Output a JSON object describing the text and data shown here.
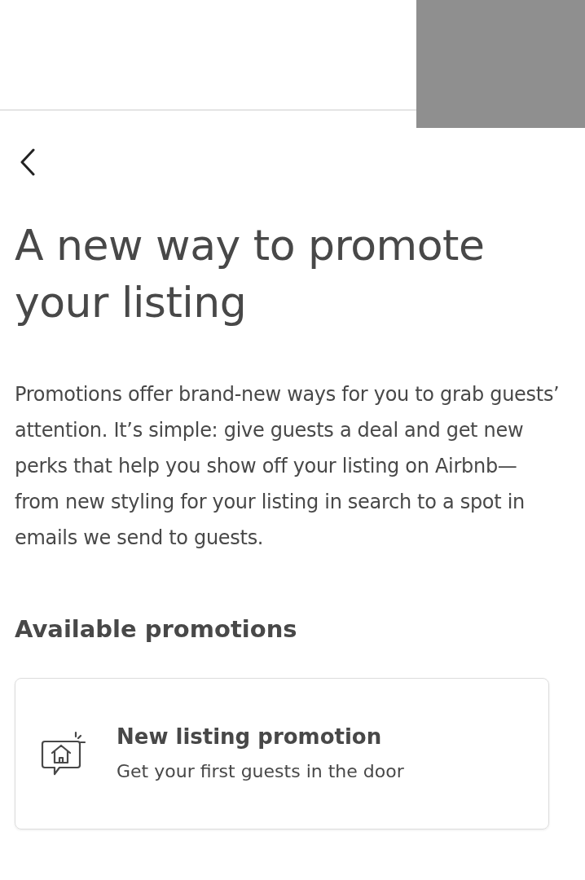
{
  "title": "A new way to promote your listing",
  "description": "Promotions offer brand-new ways for you to grab guests’ attention. It’s simple: give guests a deal and get new perks that help you show off your listing on Airbnb—from new styling for your listing in search to a spot in emails we send to guests.",
  "section_title": "Available promotions",
  "promotions": [
    {
      "title": "New listing promotion",
      "subtitle": "Get your first guests in the door"
    }
  ]
}
